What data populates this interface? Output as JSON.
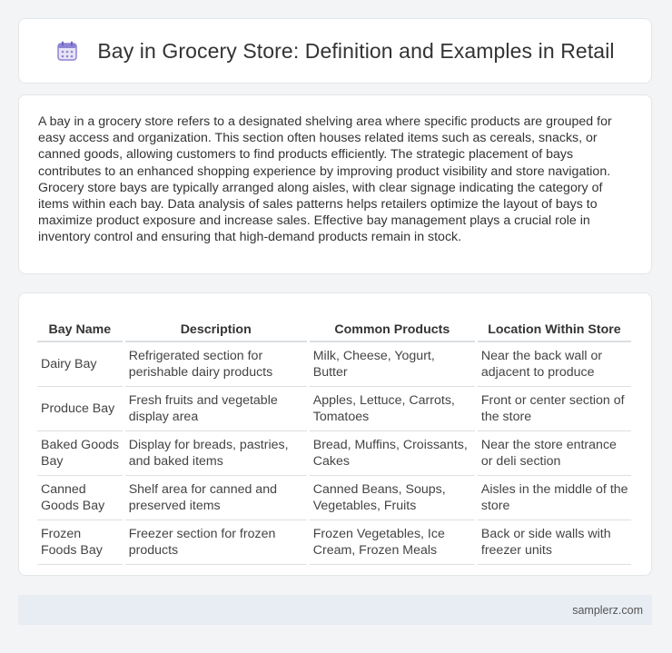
{
  "header": {
    "icon": "calendar-icon",
    "title": "Bay in Grocery Store: Definition and Examples in Retail"
  },
  "intro": {
    "text": "A bay in a grocery store refers to a designated shelving area where specific products are grouped for easy access and organization. This section often houses related items such as cereals, snacks, or canned goods, allowing customers to find products efficiently. The strategic placement of bays contributes to an enhanced shopping experience by improving product visibility and store navigation. Grocery store bays are typically arranged along aisles, with clear signage indicating the category of items within each bay. Data analysis of sales patterns helps retailers optimize the layout of bays to maximize product exposure and increase sales. Effective bay management plays a crucial role in inventory control and ensuring that high-demand products remain in stock."
  },
  "table": {
    "headers": [
      "Bay Name",
      "Description",
      "Common Products",
      "Location Within Store"
    ],
    "rows": [
      [
        "Dairy Bay",
        "Refrigerated section for perishable dairy products",
        "Milk, Cheese, Yogurt, Butter",
        "Near the back wall or adjacent to produce"
      ],
      [
        "Produce Bay",
        "Fresh fruits and vegetable display area",
        "Apples, Lettuce, Carrots, Tomatoes",
        "Front or center section of the store"
      ],
      [
        "Baked Goods Bay",
        "Display for breads, pastries, and baked items",
        "Bread, Muffins, Croissants, Cakes",
        "Near the store entrance or deli section"
      ],
      [
        "Canned Goods Bay",
        "Shelf area for canned and preserved items",
        "Canned Beans, Soups, Vegetables, Fruits",
        "Aisles in the middle of the store"
      ],
      [
        "Frozen Foods Bay",
        "Freezer section for frozen products",
        "Frozen Vegetables, Ice Cream, Frozen Meals",
        "Back or side walls with freezer units"
      ]
    ]
  },
  "footer": {
    "site": "samplerz.com"
  }
}
